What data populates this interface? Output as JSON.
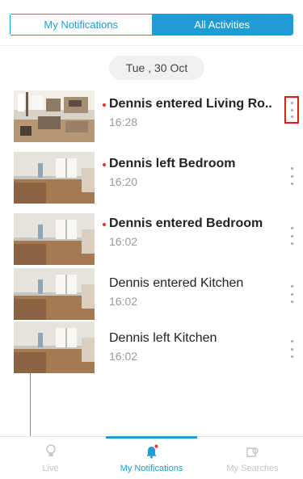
{
  "tabs": {
    "my_notifications": "My Notifications",
    "all_activities": "All Activities"
  },
  "date_label": "Tue , 30 Oct",
  "notifications": [
    {
      "title": "Dennis entered Living Ro..",
      "time": "16:28",
      "unread": true,
      "highlighted": true
    },
    {
      "title": "Dennis left Bedroom",
      "time": "16:20",
      "unread": true,
      "highlighted": false
    },
    {
      "title": "Dennis entered Bedroom",
      "time": "16:02",
      "unread": true,
      "highlighted": false
    },
    {
      "title": "Dennis entered Kitchen",
      "time": "16:02",
      "unread": false,
      "highlighted": false
    },
    {
      "title": "Dennis left Kitchen",
      "time": "16:02",
      "unread": false,
      "highlighted": false
    }
  ],
  "bottom_nav": {
    "live": "Live",
    "my_notifications": "My Notifications",
    "my_searches": "My Searches"
  },
  "colors": {
    "accent": "#1f9bd6",
    "unread_dot": "#e0343b",
    "highlight_box": "#e01818"
  },
  "icons": {
    "more": "vertical-ellipsis-icon",
    "live": "bulb-icon",
    "notifications": "bell-icon",
    "searches": "search-history-icon"
  }
}
